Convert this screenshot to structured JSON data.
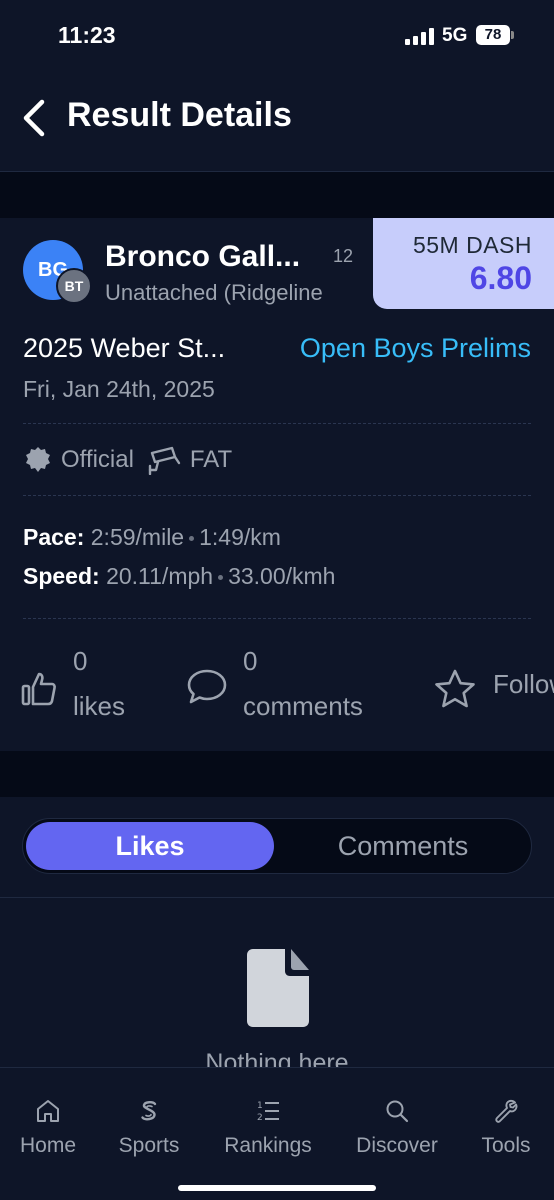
{
  "status_bar": {
    "time": "11:23",
    "network": "5G",
    "battery": "78"
  },
  "header": {
    "title": "Result Details"
  },
  "result": {
    "avatar_initials": "BG",
    "team_initials": "BT",
    "athlete_name": "Bronco Gall...",
    "grade": "12",
    "team": "Unattached (Ridgeline",
    "event": "55M DASH",
    "mark": "6.80",
    "meet_name": "2025 Weber St...",
    "race_name": "Open Boys Prelims",
    "date": "Fri, Jan 24th, 2025",
    "badges": {
      "official": "Official",
      "timing": "FAT"
    },
    "pace": {
      "label": "Pace:",
      "per_mile": "2:59/mile",
      "per_km": "1:49/km"
    },
    "speed": {
      "label": "Speed:",
      "mph": "20.11/mph",
      "kmh": "33.00/kmh"
    }
  },
  "actions": {
    "likes_count": "0",
    "likes_label": "likes",
    "comments_count": "0",
    "comments_label": "comments",
    "follow_label": "Follow"
  },
  "tabs": {
    "likes": "Likes",
    "comments": "Comments",
    "active": "Likes"
  },
  "empty_state": {
    "text": "Nothing here"
  },
  "bottom_nav": {
    "items": [
      {
        "label": "Home",
        "icon": "home-icon"
      },
      {
        "label": "Sports",
        "icon": "sports-icon"
      },
      {
        "label": "Rankings",
        "icon": "rankings-icon"
      },
      {
        "label": "Discover",
        "icon": "search-icon"
      },
      {
        "label": "Tools",
        "icon": "wrench-icon"
      }
    ]
  },
  "colors": {
    "background": "#050a17",
    "surface": "#0e1528",
    "accent": "#6366f1",
    "link": "#38bdf8",
    "event_box": "#c7cdfb",
    "mark": "#4f46e5"
  }
}
